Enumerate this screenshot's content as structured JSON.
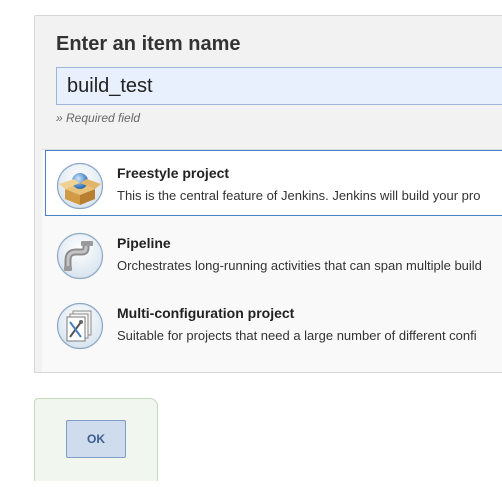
{
  "form": {
    "title": "Enter an item name",
    "item_name_value": "build_test",
    "required_hint": "» Required field"
  },
  "item_types": [
    {
      "icon": "freestyle-project-icon",
      "title": "Freestyle project",
      "description": "This is the central feature of Jenkins. Jenkins will build your pro",
      "selected": true
    },
    {
      "icon": "pipeline-icon",
      "title": "Pipeline",
      "description": "Orchestrates long-running activities that can span multiple build",
      "selected": false
    },
    {
      "icon": "multi-configuration-project-icon",
      "title": "Multi-configuration project",
      "description": "Suitable for projects that need a large number of different confi",
      "selected": false
    }
  ],
  "footer": {
    "ok_label": "OK"
  },
  "colors": {
    "selected_border": "#4a82c8",
    "input_background": "#e8f0fe",
    "ok_button": "#cfdcee"
  }
}
